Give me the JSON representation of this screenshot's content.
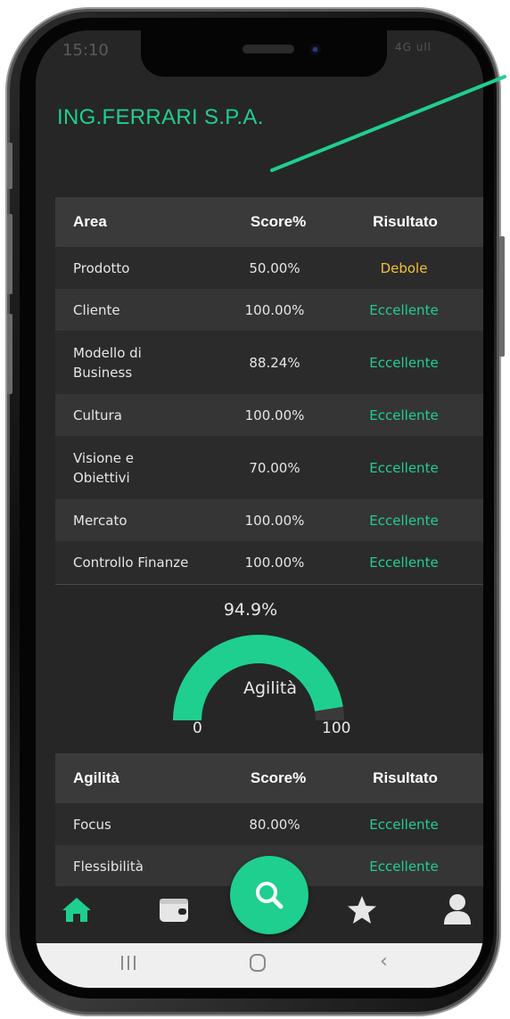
{
  "status_bar": {
    "time": "15:10",
    "right": "4G ull"
  },
  "company": {
    "name": "ING.FERRARI S.P.A."
  },
  "colors": {
    "accent": "#1fcf8f",
    "weak": "#f2c230",
    "bg": "#262626"
  },
  "areas_table": {
    "headers": {
      "area": "Area",
      "score": "Score%",
      "result": "Risultato"
    },
    "rows": [
      {
        "area": "Prodotto",
        "score": "50.00%",
        "result": "Debole"
      },
      {
        "area": "Cliente",
        "score": "100.00%",
        "result": "Eccellente"
      },
      {
        "area": "Modello di Business",
        "score": "88.24%",
        "result": "Eccellente"
      },
      {
        "area": "Cultura",
        "score": "100.00%",
        "result": "Eccellente"
      },
      {
        "area": "Visione e Obiettivi",
        "score": "70.00%",
        "result": "Eccellente"
      },
      {
        "area": "Mercato",
        "score": "100.00%",
        "result": "Eccellente"
      },
      {
        "area": "Controllo Finanze",
        "score": "100.00%",
        "result": "Eccellente"
      }
    ]
  },
  "gauge": {
    "value_text": "94.9%",
    "value": 94.9,
    "min": "0",
    "max": "100",
    "label": "Agilità"
  },
  "agility_table": {
    "headers": {
      "area": "Agilità",
      "score": "Score%",
      "result": "Risultato"
    },
    "rows": [
      {
        "area": "Focus",
        "score": "80.00%",
        "result": "Eccellente"
      },
      {
        "area": "Flessibilità",
        "score": "…%",
        "result": "Eccellente"
      }
    ]
  },
  "nav": {
    "items": [
      "home-icon",
      "wallet-icon",
      "search-icon",
      "star-icon",
      "user-icon"
    ]
  },
  "system_nav": [
    "recents-icon",
    "home-key-icon",
    "back-icon"
  ]
}
